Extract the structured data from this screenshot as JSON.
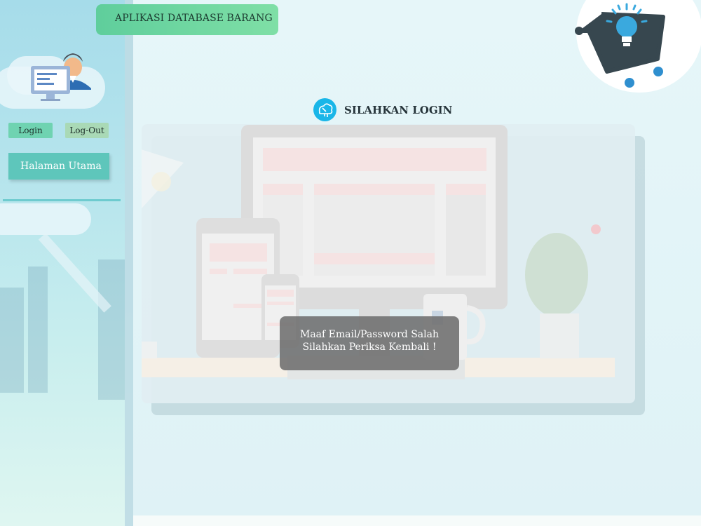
{
  "app": {
    "title": "APLIKASI DATABASE BARANG"
  },
  "sidebar": {
    "login_label": "Login",
    "logout_label": "Log-Out",
    "home_label": "Halaman Utama"
  },
  "login": {
    "title": "SILAHKAN LOGIN"
  },
  "alert": {
    "line1": "Maaf Email/Password Salah",
    "line2": "Silahkan Periksa Kembali !"
  },
  "icons": {
    "avatar": "user-computer-icon",
    "cart": "shopping-cart-lightbulb-icon",
    "login": "login-badge-icon"
  },
  "colors": {
    "title_bar": "#5fce9c",
    "login_button": "#6fd3b1",
    "logout_button": "#a9d9b6",
    "home_button": "#5ec6bb",
    "alert_bg": "#6e6e6e",
    "login_icon": "#19b6e8"
  }
}
